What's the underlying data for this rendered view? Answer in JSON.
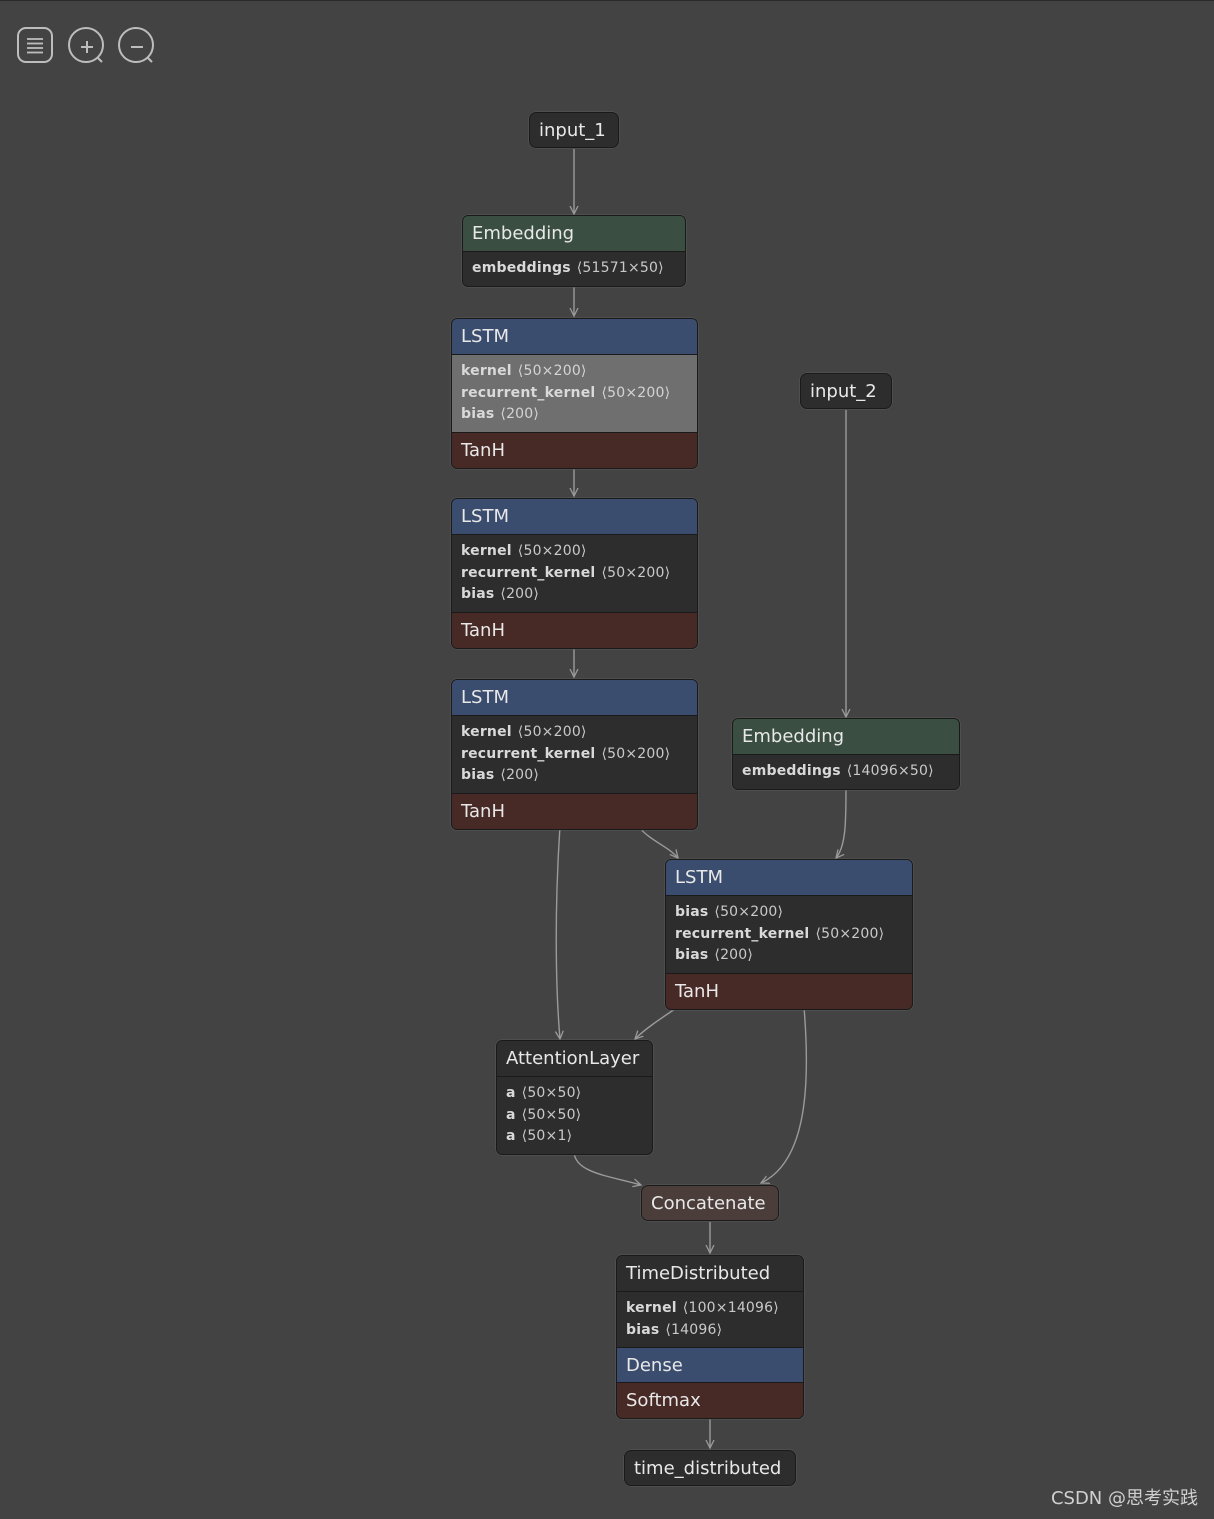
{
  "toolbar": {
    "menu_icon": "menu-icon",
    "zoom_in_icon": "zoom-in-icon",
    "zoom_out_icon": "zoom-out-icon"
  },
  "colors": {
    "background": "#434343",
    "embedding_header": "#3a4e42",
    "layer_header": "#3b4d6e",
    "activation": "#472926",
    "concatenate": "#4b3d39",
    "edge": "#9a9a9a"
  },
  "nodes": {
    "input_1": {
      "label": "input_1"
    },
    "embedding_1": {
      "title": "Embedding",
      "attrs": [
        {
          "name": "embeddings",
          "shape": "⟨51571×50⟩"
        }
      ]
    },
    "lstm_1": {
      "title": "LSTM",
      "attrs": [
        {
          "name": "kernel",
          "shape": "⟨50×200⟩"
        },
        {
          "name": "recurrent_kernel",
          "shape": "⟨50×200⟩"
        },
        {
          "name": "bias",
          "shape": "⟨200⟩"
        }
      ],
      "activation": "TanH"
    },
    "lstm_2": {
      "title": "LSTM",
      "attrs": [
        {
          "name": "kernel",
          "shape": "⟨50×200⟩"
        },
        {
          "name": "recurrent_kernel",
          "shape": "⟨50×200⟩"
        },
        {
          "name": "bias",
          "shape": "⟨200⟩"
        }
      ],
      "activation": "TanH"
    },
    "lstm_3": {
      "title": "LSTM",
      "attrs": [
        {
          "name": "kernel",
          "shape": "⟨50×200⟩"
        },
        {
          "name": "recurrent_kernel",
          "shape": "⟨50×200⟩"
        },
        {
          "name": "bias",
          "shape": "⟨200⟩"
        }
      ],
      "activation": "TanH"
    },
    "input_2": {
      "label": "input_2"
    },
    "embedding_2": {
      "title": "Embedding",
      "attrs": [
        {
          "name": "embeddings",
          "shape": "⟨14096×50⟩"
        }
      ]
    },
    "lstm_4": {
      "title": "LSTM",
      "attrs": [
        {
          "name": "bias",
          "shape": "⟨50×200⟩"
        },
        {
          "name": "recurrent_kernel",
          "shape": "⟨50×200⟩"
        },
        {
          "name": "bias",
          "shape": "⟨200⟩"
        }
      ],
      "activation": "TanH"
    },
    "attention": {
      "title": "AttentionLayer",
      "attrs": [
        {
          "name": "a",
          "shape": "⟨50×50⟩"
        },
        {
          "name": "a",
          "shape": "⟨50×50⟩"
        },
        {
          "name": "a",
          "shape": "⟨50×1⟩"
        }
      ]
    },
    "concatenate": {
      "label": "Concatenate"
    },
    "time_distributed": {
      "title": "TimeDistributed",
      "attrs": [
        {
          "name": "kernel",
          "shape": "⟨100×14096⟩"
        },
        {
          "name": "bias",
          "shape": "⟨14096⟩"
        }
      ],
      "inner": "Dense",
      "activation": "Softmax"
    },
    "output": {
      "label": "time_distributed"
    }
  },
  "watermark": "CSDN @思考实践"
}
